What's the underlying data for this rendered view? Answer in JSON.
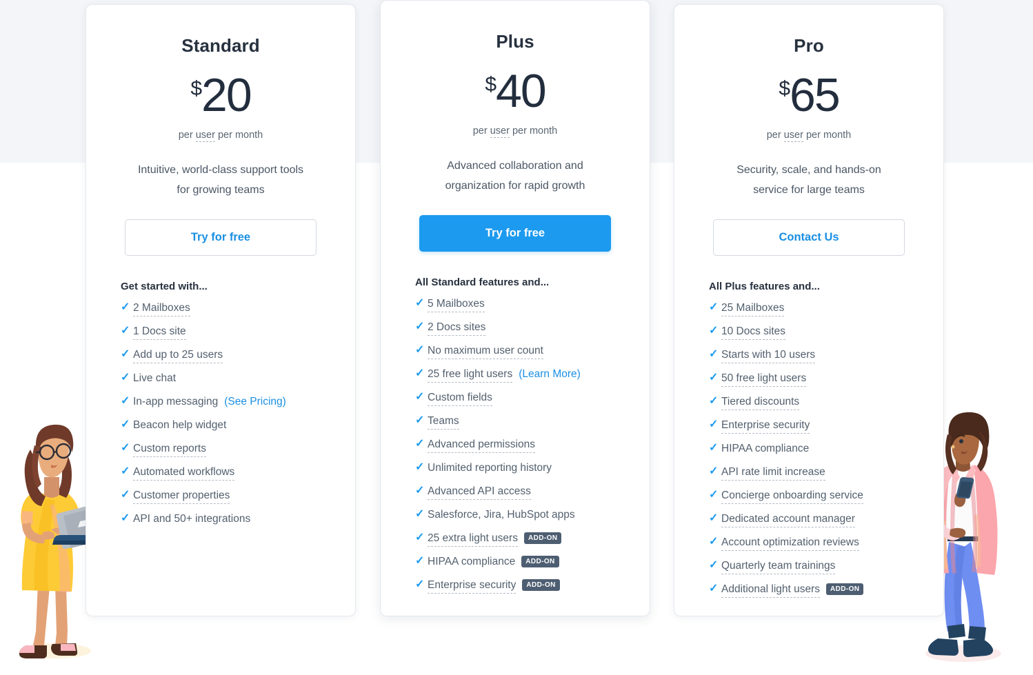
{
  "page": {
    "background_top": "#f3f5f8",
    "background_bottom": "#ffffff",
    "accent": "#1c9aef",
    "addon_badge_color": "#4e5e72"
  },
  "plans": [
    {
      "name": "Standard",
      "currency": "$",
      "price": "20",
      "period": "per user per month",
      "period_prefix": "per ",
      "period_dotted": "user",
      "period_suffix": " per month",
      "tagline_line1": "Intuitive, world-class support tools",
      "tagline_line2": "for growing teams",
      "cta_label": "Try for free",
      "features_heading": "Get started with...",
      "features": [
        {
          "label": "2 Mailboxes",
          "dotted": true
        },
        {
          "label": "1 Docs site",
          "dotted": true
        },
        {
          "label": "Add up to 25 users",
          "dotted": true
        },
        {
          "label": "Live chat",
          "dotted": false
        },
        {
          "label": "In-app messaging",
          "dotted": false,
          "link": "(See Pricing)"
        },
        {
          "label": "Beacon help widget",
          "dotted": false
        },
        {
          "label": "Custom reports",
          "dotted": true
        },
        {
          "label": "Automated workflows",
          "dotted": true
        },
        {
          "label": "Customer properties",
          "dotted": true
        },
        {
          "label": "API and 50+ integrations",
          "dotted": false
        }
      ]
    },
    {
      "name": "Plus",
      "currency": "$",
      "price": "40",
      "period": "per user per month",
      "period_prefix": "per ",
      "period_dotted": "user",
      "period_suffix": " per month",
      "tagline_line1": "Advanced collaboration and",
      "tagline_line2": "organization for rapid growth",
      "cta_label": "Try for free",
      "features_heading": "All Standard features and...",
      "features": [
        {
          "label": "5 Mailboxes",
          "dotted": true
        },
        {
          "label": "2 Docs sites",
          "dotted": true
        },
        {
          "label": "No maximum user count",
          "dotted": true
        },
        {
          "label": "25 free light users",
          "dotted": true,
          "link": "(Learn More)"
        },
        {
          "label": "Custom fields",
          "dotted": true
        },
        {
          "label": "Teams",
          "dotted": true
        },
        {
          "label": "Advanced permissions",
          "dotted": true
        },
        {
          "label": "Unlimited reporting history",
          "dotted": false
        },
        {
          "label": "Advanced API access",
          "dotted": true
        },
        {
          "label": "Salesforce, Jira, HubSpot apps",
          "dotted": false
        },
        {
          "label": "25 extra light users",
          "dotted": true,
          "badge": "ADD-ON"
        },
        {
          "label": "HIPAA compliance",
          "dotted": false,
          "badge": "ADD-ON"
        },
        {
          "label": "Enterprise security",
          "dotted": true,
          "badge": "ADD-ON"
        }
      ]
    },
    {
      "name": "Pro",
      "currency": "$",
      "price": "65",
      "period": "per user per month",
      "period_prefix": "per ",
      "period_dotted": "user",
      "period_suffix": " per month",
      "tagline_line1": "Security, scale, and hands-on",
      "tagline_line2": "service for large teams",
      "cta_label": "Contact Us",
      "features_heading": "All Plus features and...",
      "features": [
        {
          "label": "25 Mailboxes",
          "dotted": true
        },
        {
          "label": "10 Docs sites",
          "dotted": true
        },
        {
          "label": "Starts with 10 users",
          "dotted": true
        },
        {
          "label": "50 free light users",
          "dotted": true
        },
        {
          "label": "Tiered discounts",
          "dotted": true
        },
        {
          "label": "Enterprise security",
          "dotted": true
        },
        {
          "label": "HIPAA compliance",
          "dotted": false
        },
        {
          "label": "API rate limit increase",
          "dotted": true
        },
        {
          "label": "Concierge onboarding service",
          "dotted": true
        },
        {
          "label": "Dedicated account manager",
          "dotted": true
        },
        {
          "label": "Account optimization reviews",
          "dotted": true
        },
        {
          "label": "Quarterly team trainings",
          "dotted": true
        },
        {
          "label": "Additional light users",
          "dotted": true,
          "badge": "ADD-ON"
        }
      ]
    }
  ],
  "illustrations": {
    "left": "woman-with-laptop-illustration",
    "right": "woman-with-phone-illustration"
  }
}
